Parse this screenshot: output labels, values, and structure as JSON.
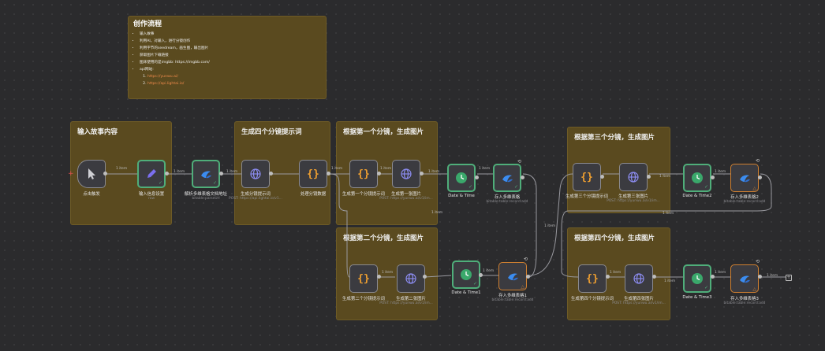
{
  "note": {
    "title": "创作流程",
    "bullets": [
      "输入故事",
      "利用AI，对输入，进行分镜创作",
      "利用字节的seedream，画生图，输出图片",
      "获取图片下载链接",
      "图床使用的是imgbb: https://imgbb.com/",
      "api网站:"
    ],
    "links": [
      "https://yunwu.ai/",
      "https://api.lightai.io/"
    ]
  },
  "groups": [
    {
      "title": "输入故事内容"
    },
    {
      "title": "生成四个分镜提示词"
    },
    {
      "title": "根据第一个分镜，生成图片"
    },
    {
      "title": "根据第二个分镜，生成图片"
    },
    {
      "title": "根据第三个分镜，生成图片"
    },
    {
      "title": "根据第四个分镜，生成图片"
    }
  ],
  "nodes": [
    {
      "label": "点击触发",
      "sub": ""
    },
    {
      "label": "输入信息设置",
      "sub": "raw"
    },
    {
      "label": "解析多维表格文档地址",
      "sub": "bitable:parseUrl"
    },
    {
      "label": "生成分镜提示词",
      "sub": "POST: https://api.lightai.io/v1..."
    },
    {
      "label": "处理分镜数据",
      "sub": ""
    },
    {
      "label": "生成第一个分镜提示词",
      "sub": ""
    },
    {
      "label": "生成第一张图片",
      "sub": "POST: https://yunwu.ai/v1/im..."
    },
    {
      "label": "Date & Time",
      "sub": ""
    },
    {
      "label": "存入多维表格",
      "sub": "bitable:table:record:add"
    },
    {
      "label": "生成第二个分镜提示词",
      "sub": ""
    },
    {
      "label": "生成第二张图片",
      "sub": "POST: https://yunwu.ai/v1/im..."
    },
    {
      "label": "Date & Time1",
      "sub": ""
    },
    {
      "label": "存入多维表格1",
      "sub": "bitable:table:record:add"
    },
    {
      "label": "生成第三个分镜提示词",
      "sub": ""
    },
    {
      "label": "生成第三张图片",
      "sub": "POST: https://yunwu.ai/v1/im..."
    },
    {
      "label": "Date & Time2",
      "sub": ""
    },
    {
      "label": "存入多维表格2",
      "sub": "bitable:table:record:add"
    },
    {
      "label": "生成第四个分镜提示词",
      "sub": ""
    },
    {
      "label": "生成第四张图片",
      "sub": "POST: https://yunwu.ai/v1/im..."
    },
    {
      "label": "Date & Time3",
      "sub": ""
    },
    {
      "label": "存入多维表格3",
      "sub": "bitable:table:record:add"
    }
  ],
  "edge_label": "1 item",
  "icons": {
    "trigger": "cursor-icon",
    "set": "pencil-icon",
    "bitable": "lark-icon",
    "http": "globe-icon",
    "code": "braces-icon",
    "datetime": "clock-icon"
  },
  "colors": {
    "sticky": "#5a4a1f",
    "selected": "#4fae7a",
    "warning": "#d08030",
    "link": "#f08a4b",
    "http": "#6b6bd6",
    "clock": "#3aa86b"
  }
}
